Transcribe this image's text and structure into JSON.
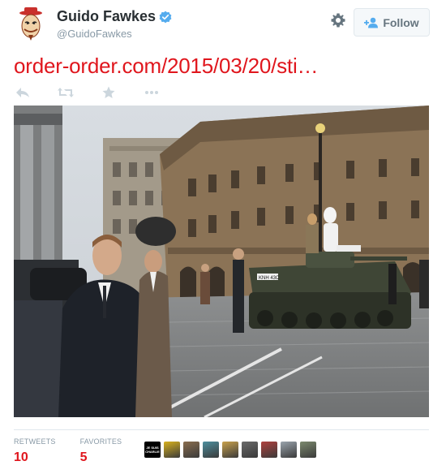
{
  "author": {
    "display_name": "Guido Fawkes",
    "handle": "@GuidoFawkes",
    "verified": true,
    "avatar_icon": "guy-fawkes-mask-icon"
  },
  "header": {
    "settings_icon": "gear-icon",
    "follow_label": "Follow",
    "follow_icon": "add-user-icon"
  },
  "tweet": {
    "text": "order-order.com/2015/03/20/sti…",
    "link_color": "#e0161d"
  },
  "actions": [
    {
      "name": "reply-icon"
    },
    {
      "name": "retweet-icon"
    },
    {
      "name": "favorite-star-icon"
    },
    {
      "name": "more-dots-icon"
    }
  ],
  "media": {
    "tank_plate": "KNH 43C"
  },
  "stats": {
    "retweets_label": "RETWEETS",
    "retweets_count": "10",
    "favorites_label": "FAVORITES",
    "favorites_count": "5"
  },
  "favoriters": [
    {
      "type": "charlie",
      "text": "JE SUIS CHARLIE"
    },
    {
      "type": "photo",
      "color": "#d9b21d"
    },
    {
      "type": "photo",
      "color": "#8a6d4e"
    },
    {
      "type": "photo",
      "color": "#4d8f9e"
    },
    {
      "type": "photo",
      "color": "#c9a24c"
    },
    {
      "type": "photo",
      "color": "#6a6a6a"
    },
    {
      "type": "photo",
      "color": "#b0413e"
    },
    {
      "type": "photo",
      "color": "#9aa4ad"
    },
    {
      "type": "photo",
      "color": "#7c8a6e"
    }
  ],
  "colors": {
    "accent": "#e0161d",
    "muted": "#8899a6",
    "verified_blue": "#55acee"
  }
}
